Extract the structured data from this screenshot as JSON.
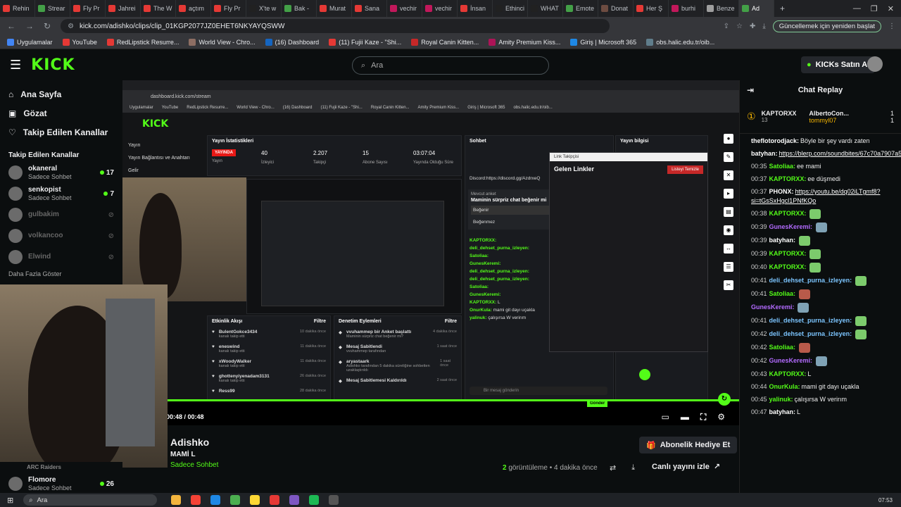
{
  "browser": {
    "tabs": [
      "Rehin",
      "Strear",
      "Fly Pr",
      "Jahrei",
      "The W",
      "açtım",
      "Fly Pr",
      "X'te w",
      "Bak -",
      "Murat",
      "Sana",
      "vechir",
      "vechir",
      "İnsan",
      "Ethinci",
      "WHAT",
      "Emote",
      "Donat",
      "Her Ş",
      "burhi",
      "Benze",
      "Ad"
    ],
    "url": "kick.com/adishko/clips/clip_01KGP2077JZ0EHET6NKYAYQSWW",
    "update_label": "Güncellemek için yeniden başlat",
    "bookmarks": [
      "Uygulamalar",
      "YouTube",
      "RedLipstick Resurre...",
      "World View - Chro...",
      "(16) Dashboard",
      "(11) Fujii Kaze - \"Shi...",
      "Royal Canin Kitten...",
      "Amity Premium Kiss...",
      "Giriş | Microsoft 365",
      "obs.halic.edu.tr/oib..."
    ]
  },
  "header": {
    "logo": "KICK",
    "logo_tag": "BETA",
    "search_placeholder": "Ara",
    "kicks_button": "KICKs Satın Al"
  },
  "sidebar": {
    "nav": [
      {
        "label": "Ana Sayfa",
        "icon": "home-icon"
      },
      {
        "label": "Gözat",
        "icon": "browse-icon"
      },
      {
        "label": "Takip Edilen Kanallar",
        "icon": "heart-icon"
      }
    ],
    "section_title": "Takip Edilen Kanallar",
    "channels": [
      {
        "name": "okaneral",
        "sub": "Sadece Sohbet",
        "count": "17",
        "live": true
      },
      {
        "name": "senkopist",
        "sub": "Sadece Sohbet",
        "count": "7",
        "live": true
      },
      {
        "name": "gulbakim",
        "sub": "",
        "count": "",
        "live": false
      },
      {
        "name": "volkancoo",
        "sub": "",
        "count": "",
        "live": false
      },
      {
        "name": "Elwind",
        "sub": "",
        "count": "",
        "live": false
      }
    ],
    "more": "Daha Fazla Göster",
    "bottom": [
      {
        "name": "ARC Raiders",
        "sub": "",
        "count": ""
      },
      {
        "name": "Flomore",
        "sub": "Sadece Sohbet",
        "count": "26"
      }
    ]
  },
  "dashboard": {
    "url": "dashboard.kick.com/stream",
    "left_nav": [
      "Yayın",
      "Yayın Bağlantısı ve Anahtarı",
      "Gelir"
    ],
    "stats_title": "Yayın İstatistikleri",
    "stats": [
      {
        "value": "YAYINDA",
        "label": "Yayın"
      },
      {
        "value": "40",
        "label": "İzleyici"
      },
      {
        "value": "2.207",
        "label": "Takipçi"
      },
      {
        "value": "15",
        "label": "Abone Sayısı"
      },
      {
        "value": "03:07:04",
        "label": "Yayında Olduğu Süre"
      }
    ],
    "chat_title": "Sohbet",
    "info_title": "Yayın bilgisi",
    "activity_title": "Etkinlik Akışı",
    "filter": "Filtre",
    "activity": [
      {
        "name": "BulentGokce3434",
        "desc": "kanalı takip etti",
        "time": "10 dakika önce"
      },
      {
        "name": "eneswind",
        "desc": "kanalı takip etti",
        "time": "11 dakika önce"
      },
      {
        "name": "xWoodyWalker",
        "desc": "kanalı takip etti",
        "time": "11 dakika önce"
      },
      {
        "name": "ghotteny­iyenadam3131",
        "desc": "kanalı takip etti",
        "time": "26 dakika önce"
      },
      {
        "name": "Ress99",
        "desc": "",
        "time": "28 dakika önce"
      }
    ],
    "mod_title": "Denetim Eylemleri",
    "mod": [
      {
        "name": "vvuhammep bir Anket başlattı",
        "desc": "Maminin sürpriz chat beğenir mi?",
        "time": "4 dakika önce"
      },
      {
        "name": "Mesaj Sabitlendi",
        "desc": "vvuhammep tarafından",
        "time": "1 saat önce"
      },
      {
        "name": "aryastaark",
        "desc": "Adishko tarafından 5 dakika süreliğine sohbetten uzaklaştırıldı",
        "time": "1 saat önce"
      },
      {
        "name": "Mesaj Sabitlemesi Kaldırıldı",
        "desc": "",
        "time": "2 saat önce"
      }
    ],
    "poll_label": "Mevcut anket",
    "poll_question": "Maminin sürpriz chat beğenir mi",
    "poll_options": [
      "Beğenir",
      "Beğenmez"
    ],
    "chat_lines": [
      {
        "user": "KAPTORXX:",
        "text": ""
      },
      {
        "user": "deli_dehset_purna_izleyen:",
        "text": ""
      },
      {
        "user": "Satoliaa:",
        "text": ""
      },
      {
        "user": "GunesKeremi:",
        "text": ""
      },
      {
        "user": "deli_dehset_purna_izleyen:",
        "text": ""
      },
      {
        "user": "deli_dehset_purna_izleyen:",
        "text": ""
      },
      {
        "user": "Satoliaa:",
        "text": ""
      },
      {
        "user": "GunesKeremi:",
        "text": ""
      },
      {
        "user": "KAPTORXX:",
        "text": "L"
      },
      {
        "user": "OnurKula:",
        "text": "mami git dayı uçakla"
      },
      {
        "user": "yalinuk:",
        "text": "çalışırsa W verirım"
      }
    ],
    "chat_placeholder": "Bir mesaj gönderin",
    "send": "Gönder",
    "discord": "Discord:https://discord.gg/AzdrxeQ",
    "overlay_title": "Link Takipçisi",
    "overlay_header": "Gelen Linkler",
    "overlay_clear": "Listeyi Temizle"
  },
  "player": {
    "time": "00:48 / 00:48",
    "progress_fraction": 1.0
  },
  "clip": {
    "streamer": "Adishko",
    "title": "MAMİ L",
    "category": "Sadece Sohbet",
    "gift_button": "Abonelik Hediye Et",
    "views_count": "2",
    "views_suffix": "görüntüleme • 4 dakika önce",
    "watch_live": "Canlı yayını izle"
  },
  "chat": {
    "title": "Chat Replay",
    "leaders": [
      {
        "name": "KAPTORXX",
        "sub": "13"
      },
      {
        "name": "AlbertoCon...",
        "sub": "1"
      },
      {
        "name": "tommyl07",
        "sub": "1"
      }
    ],
    "messages": [
      {
        "time": "",
        "user": "theflotorodjack:",
        "text": "Böyle bir şey vardı zaten",
        "color": "#ffffff",
        "emote": ""
      },
      {
        "time": "",
        "user": "batyhan:",
        "text": "https://blerp.com/soundbites/67c70a7907a5ba844f97a578",
        "color": "#ffffff",
        "emote": "",
        "link": true
      },
      {
        "time": "00:35",
        "user": "Satoliaa:",
        "text": "ee mami",
        "color": "#53fc18",
        "emote": ""
      },
      {
        "time": "00:37",
        "user": "KAPTORXX:",
        "text": "ee düşmedi",
        "color": "#53fc18",
        "emote": ""
      },
      {
        "time": "00:37",
        "user": "PHONX:",
        "text": "https://youtu.be/dq02iLTgmf8?si=tGsSxHgcl1PNfKQo",
        "color": "#ffffff",
        "emote": "",
        "link": true
      },
      {
        "time": "00:38",
        "user": "KAPTORXX:",
        "text": "",
        "color": "#53fc18",
        "emote": "green"
      },
      {
        "time": "00:39",
        "user": "GunesKeremi:",
        "text": "",
        "color": "#b36bff",
        "emote": "blue"
      },
      {
        "time": "00:39",
        "user": "batyhan:",
        "text": "",
        "color": "#ffffff",
        "emote": "green"
      },
      {
        "time": "00:39",
        "user": "KAPTORXX:",
        "text": "",
        "color": "#53fc18",
        "emote": "green"
      },
      {
        "time": "00:40",
        "user": "KAPTORXX:",
        "text": "",
        "color": "#53fc18",
        "emote": "green"
      },
      {
        "time": "00:41",
        "user": "deli_dehset_purna_izleyen:",
        "text": "",
        "color": "#7cc5ff",
        "emote": "green"
      },
      {
        "time": "00:41",
        "user": "Satoliaa:",
        "text": "",
        "color": "#53fc18",
        "emote": "red"
      },
      {
        "time": "",
        "user": "GunesKeremi:",
        "text": "",
        "color": "#b36bff",
        "emote": "blue"
      },
      {
        "time": "00:41",
        "user": "deli_dehset_purna_izleyen:",
        "text": "",
        "color": "#7cc5ff",
        "emote": "green"
      },
      {
        "time": "00:42",
        "user": "deli_dehset_purna_izleyen:",
        "text": "",
        "color": "#7cc5ff",
        "emote": "green"
      },
      {
        "time": "00:42",
        "user": "Satoliaa:",
        "text": "",
        "color": "#53fc18",
        "emote": "red"
      },
      {
        "time": "00:42",
        "user": "GunesKeremi:",
        "text": "",
        "color": "#b36bff",
        "emote": "blue"
      },
      {
        "time": "00:43",
        "user": "KAPTORXX:",
        "text": "L",
        "color": "#53fc18",
        "emote": ""
      },
      {
        "time": "00:44",
        "user": "OnurKula:",
        "text": "mami git dayı uçakla",
        "color": "#53fc18",
        "emote": ""
      },
      {
        "time": "00:45",
        "user": "yalinuk:",
        "text": "çalışırsa W verirım",
        "color": "#53fc18",
        "emote": ""
      },
      {
        "time": "00:47",
        "user": "batyhan:",
        "text": "L",
        "color": "#ffffff",
        "emote": ""
      }
    ]
  },
  "taskbar": {
    "search": "Ara",
    "time": "07:53"
  },
  "colors": {
    "accent": "#53fc18",
    "bg": "#0b0e0f",
    "panel": "#191b1f"
  }
}
